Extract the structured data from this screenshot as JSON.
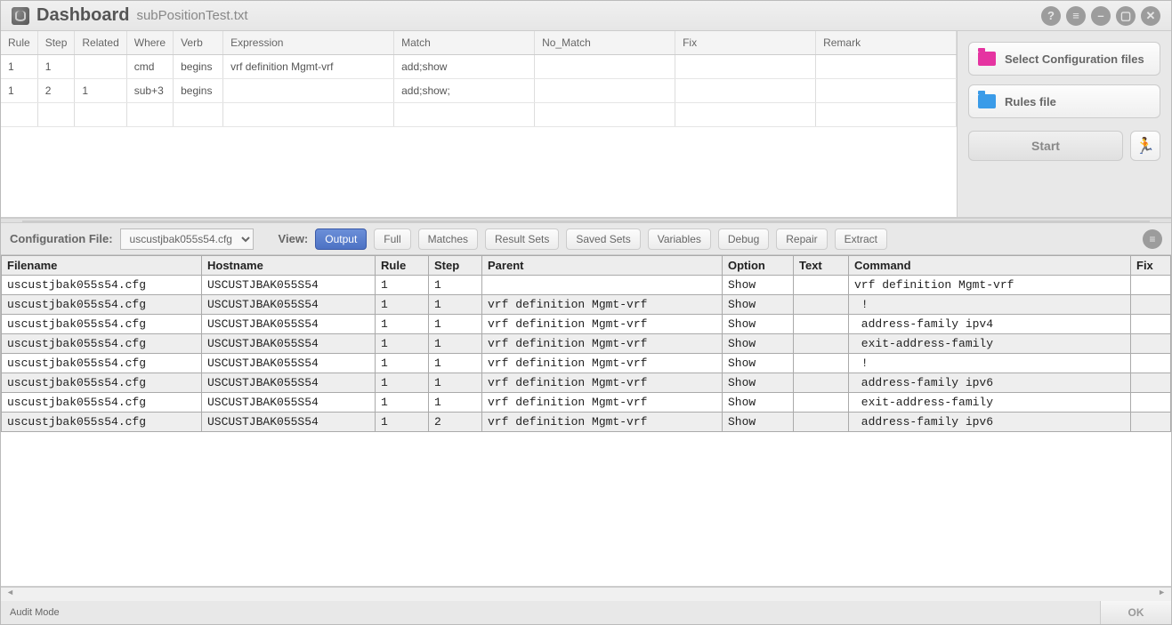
{
  "window": {
    "title": "Dashboard",
    "subtitle": "subPositionTest.txt"
  },
  "rules": {
    "headers": [
      "Rule",
      "Step",
      "Related",
      "Where",
      "Verb",
      "Expression",
      "Match",
      "No_Match",
      "Fix",
      "Remark"
    ],
    "rows": [
      {
        "rule": "1",
        "step": "1",
        "related": "",
        "where": "cmd",
        "verb": "begins",
        "expr": "vrf definition Mgmt-vrf",
        "match": "add;show",
        "nomatch": "",
        "fix": "",
        "remark": ""
      },
      {
        "rule": "1",
        "step": "2",
        "related": "1",
        "where": "sub+3",
        "verb": "begins",
        "expr": "",
        "match": "add;show;",
        "nomatch": "",
        "fix": "",
        "remark": ""
      }
    ]
  },
  "side": {
    "select_config": "Select Configuration files",
    "rules_file": "Rules file",
    "start": "Start"
  },
  "toolbar": {
    "config_label": "Configuration File:",
    "config_value": "uscustjbak055s54.cfg",
    "view_label": "View:",
    "buttons": {
      "output": "Output",
      "full": "Full",
      "matches": "Matches",
      "result_sets": "Result Sets",
      "saved_sets": "Saved Sets",
      "variables": "Variables",
      "debug": "Debug",
      "repair": "Repair",
      "extract": "Extract"
    }
  },
  "output": {
    "headers": [
      "Filename",
      "Hostname",
      "Rule",
      "Step",
      "Parent",
      "Option",
      "Text",
      "Command",
      "Fix"
    ],
    "rows": [
      {
        "filename": "uscustjbak055s54.cfg",
        "hostname": "USCUSTJBAK055S54",
        "rule": "1",
        "step": "1",
        "parent": "",
        "option": "Show",
        "text": "",
        "command": "vrf definition Mgmt-vrf",
        "fix": ""
      },
      {
        "filename": "uscustjbak055s54.cfg",
        "hostname": "USCUSTJBAK055S54",
        "rule": "1",
        "step": "1",
        "parent": "vrf definition Mgmt-vrf",
        "option": "Show",
        "text": "",
        "command": " !",
        "fix": ""
      },
      {
        "filename": "uscustjbak055s54.cfg",
        "hostname": "USCUSTJBAK055S54",
        "rule": "1",
        "step": "1",
        "parent": "vrf definition Mgmt-vrf",
        "option": "Show",
        "text": "",
        "command": " address-family ipv4",
        "fix": ""
      },
      {
        "filename": "uscustjbak055s54.cfg",
        "hostname": "USCUSTJBAK055S54",
        "rule": "1",
        "step": "1",
        "parent": "vrf definition Mgmt-vrf",
        "option": "Show",
        "text": "",
        "command": " exit-address-family",
        "fix": ""
      },
      {
        "filename": "uscustjbak055s54.cfg",
        "hostname": "USCUSTJBAK055S54",
        "rule": "1",
        "step": "1",
        "parent": "vrf definition Mgmt-vrf",
        "option": "Show",
        "text": "",
        "command": " !",
        "fix": ""
      },
      {
        "filename": "uscustjbak055s54.cfg",
        "hostname": "USCUSTJBAK055S54",
        "rule": "1",
        "step": "1",
        "parent": "vrf definition Mgmt-vrf",
        "option": "Show",
        "text": "",
        "command": " address-family ipv6",
        "fix": ""
      },
      {
        "filename": "uscustjbak055s54.cfg",
        "hostname": "USCUSTJBAK055S54",
        "rule": "1",
        "step": "1",
        "parent": "vrf definition Mgmt-vrf",
        "option": "Show",
        "text": "",
        "command": " exit-address-family",
        "fix": ""
      },
      {
        "filename": "uscustjbak055s54.cfg",
        "hostname": "USCUSTJBAK055S54",
        "rule": "1",
        "step": "2",
        "parent": "vrf definition Mgmt-vrf",
        "option": "Show",
        "text": "",
        "command": " address-family ipv6",
        "fix": ""
      }
    ]
  },
  "status": {
    "mode": "Audit Mode",
    "ok": "OK"
  }
}
